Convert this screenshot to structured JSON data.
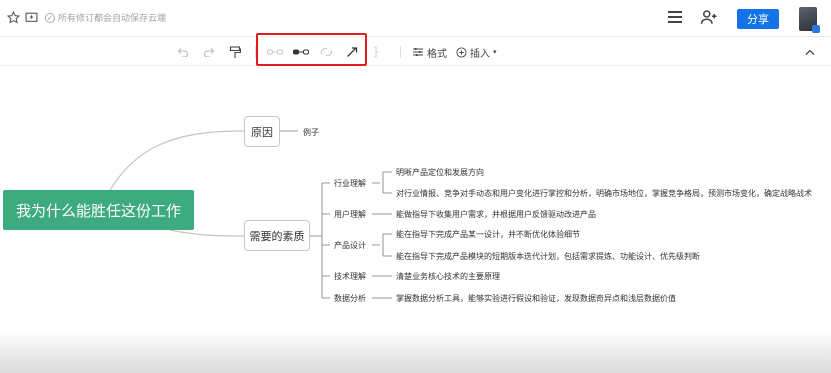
{
  "header": {
    "autosave_text": "所有修订都会自动保存云端",
    "share_label": "分享"
  },
  "toolbar": {
    "format_label": "格式",
    "insert_label": "插入"
  },
  "mindmap": {
    "root": "我为什么能胜任这份工作",
    "cause": {
      "label": "原因",
      "child": "例子"
    },
    "quality": {
      "label": "需要的素质",
      "categories": [
        {
          "label": "行业理解",
          "items": [
            "明晰产品定位和发展方向",
            "对行业情报、竞争对手动态和用户变化进行掌控和分析，明确市场地位，掌握竞争格局，预测市场变化，确定战略战术"
          ]
        },
        {
          "label": "用户理解",
          "items": [
            "能做指导下收集用户需求，并根据用户反馈驱动改进产品"
          ]
        },
        {
          "label": "产品设计",
          "items": [
            "能在指导下完成产品某一设计，并不断优化体验细节",
            "能在指导下完成产品模块的短期版本迭代计划，包括需求提炼、功能设计、优先级判断"
          ]
        },
        {
          "label": "技术理解",
          "items": [
            "清楚业务核心技术的主要原理"
          ]
        },
        {
          "label": "数据分析",
          "items": [
            "掌握数据分析工具，能够实验进行假设和验证，发现数据奇异点和浅层数据价值"
          ]
        }
      ]
    }
  },
  "colors": {
    "root_bg": "#3eaa80",
    "share_bg": "#1473e6",
    "highlight": "#e21d1d"
  }
}
